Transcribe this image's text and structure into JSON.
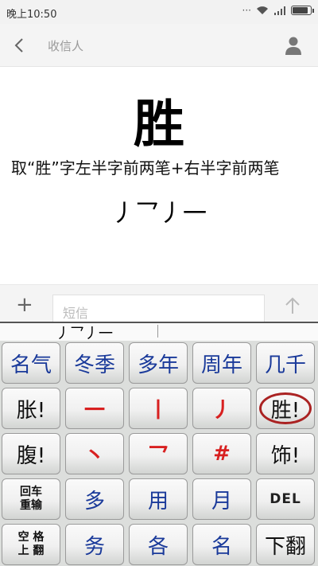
{
  "status": {
    "time": "晚上10:50"
  },
  "header": {
    "recipient": "收信人"
  },
  "content": {
    "big_char": "胜",
    "description": "取“胜”字左半字前两笔+右半字前两笔",
    "strokes": "丿乛丿一"
  },
  "compose": {
    "placeholder": "短信"
  },
  "ime": {
    "composition": "丿乛丿一",
    "rows": [
      [
        "名气",
        "冬季",
        "多年",
        "周年",
        "几千"
      ],
      [
        "胀!",
        "一",
        "丨",
        "丿",
        "胜!"
      ],
      [
        "腹!",
        "丶",
        "乛",
        "#",
        "饰!"
      ],
      [
        "回车\n重输",
        "多",
        "用",
        "月",
        "DEL"
      ],
      [
        "空 格\n上 翻",
        "务",
        "各",
        "名",
        "下翻"
      ]
    ],
    "selected": "胜!"
  }
}
